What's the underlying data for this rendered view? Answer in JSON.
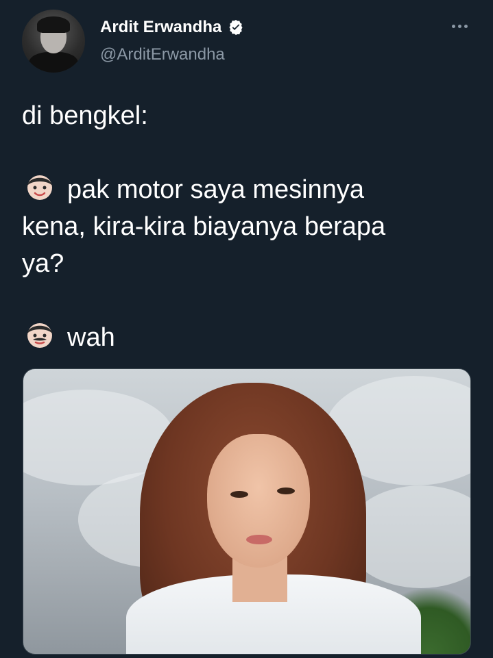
{
  "tweet": {
    "author": {
      "display_name": "Ardit Erwandha",
      "handle": "@ArditErwandha",
      "verified": true
    },
    "more_icon": "more-horizontal-icon",
    "text_lines": [
      "di bengkel:",
      "",
      "pak motor saya mesinnya",
      "kena, kira-kira biayanya berapa",
      "ya?",
      "",
      "wah"
    ],
    "emojis": [
      "boy-face-emoji",
      "man-with-mustache-emoji"
    ],
    "media": {
      "type": "photo",
      "description": "portrait photo"
    }
  },
  "colors": {
    "background": "#15202b",
    "text_primary": "#ffffff",
    "text_secondary": "#8b98a5",
    "border": "#38444d"
  }
}
